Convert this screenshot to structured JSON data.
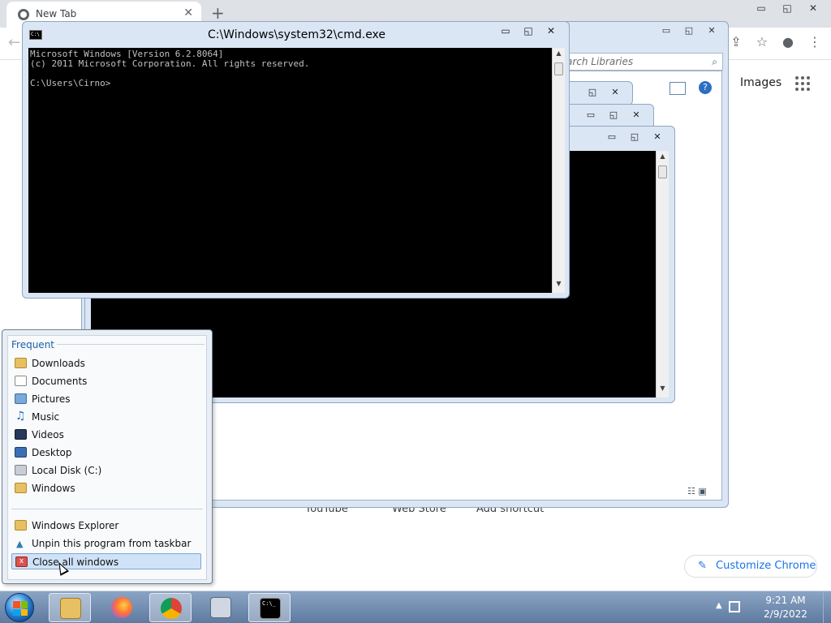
{
  "chrome": {
    "tab_title": "New Tab",
    "tab_close": "✕",
    "new_tab": "+",
    "window_buttons": [
      "▭",
      "◱",
      "✕"
    ],
    "back": "←",
    "toolbar_icons": [
      "⇪",
      "☆",
      "●",
      "⋮"
    ],
    "images_link": "Images",
    "shortcuts": [
      "YouTube",
      "Web Store",
      "Add shortcut"
    ],
    "customize_label": "Customize Chrome",
    "customize_icon": "✎"
  },
  "explorer": {
    "search_placeholder": "arch Libraries",
    "search_icon": "⌕",
    "window_buttons": [
      "▭",
      "◱",
      "✕"
    ]
  },
  "back_cmd_windows": {
    "buttons": [
      "▭",
      "◱",
      "✕"
    ]
  },
  "cmd": {
    "title": "C:\\Windows\\system32\\cmd.exe",
    "icon_text": "C:\\",
    "buttons": [
      "▭",
      "◱",
      "✕"
    ],
    "lines": [
      "Microsoft Windows [Version 6.2.8064]",
      "(c) 2011 Microsoft Corporation. All rights reserved.",
      "",
      "C:\\Users\\Cirno>"
    ],
    "scroll_up": "▲",
    "scroll_down": "▼"
  },
  "jumplist": {
    "section_frequent": "Frequent",
    "frequent": [
      "Downloads",
      "Documents",
      "Pictures",
      "Music",
      "Videos",
      "Desktop",
      "Local Disk (C:)",
      "Windows"
    ],
    "tasks": [
      "Windows Explorer",
      "Unpin this program from taskbar",
      "Close all windows"
    ],
    "close_icon": "x"
  },
  "taskbar": {
    "time": "9:21 AM",
    "date": "2/9/2022",
    "tray_arrow": "▲",
    "cmd_icon_text": "C:\\_"
  }
}
